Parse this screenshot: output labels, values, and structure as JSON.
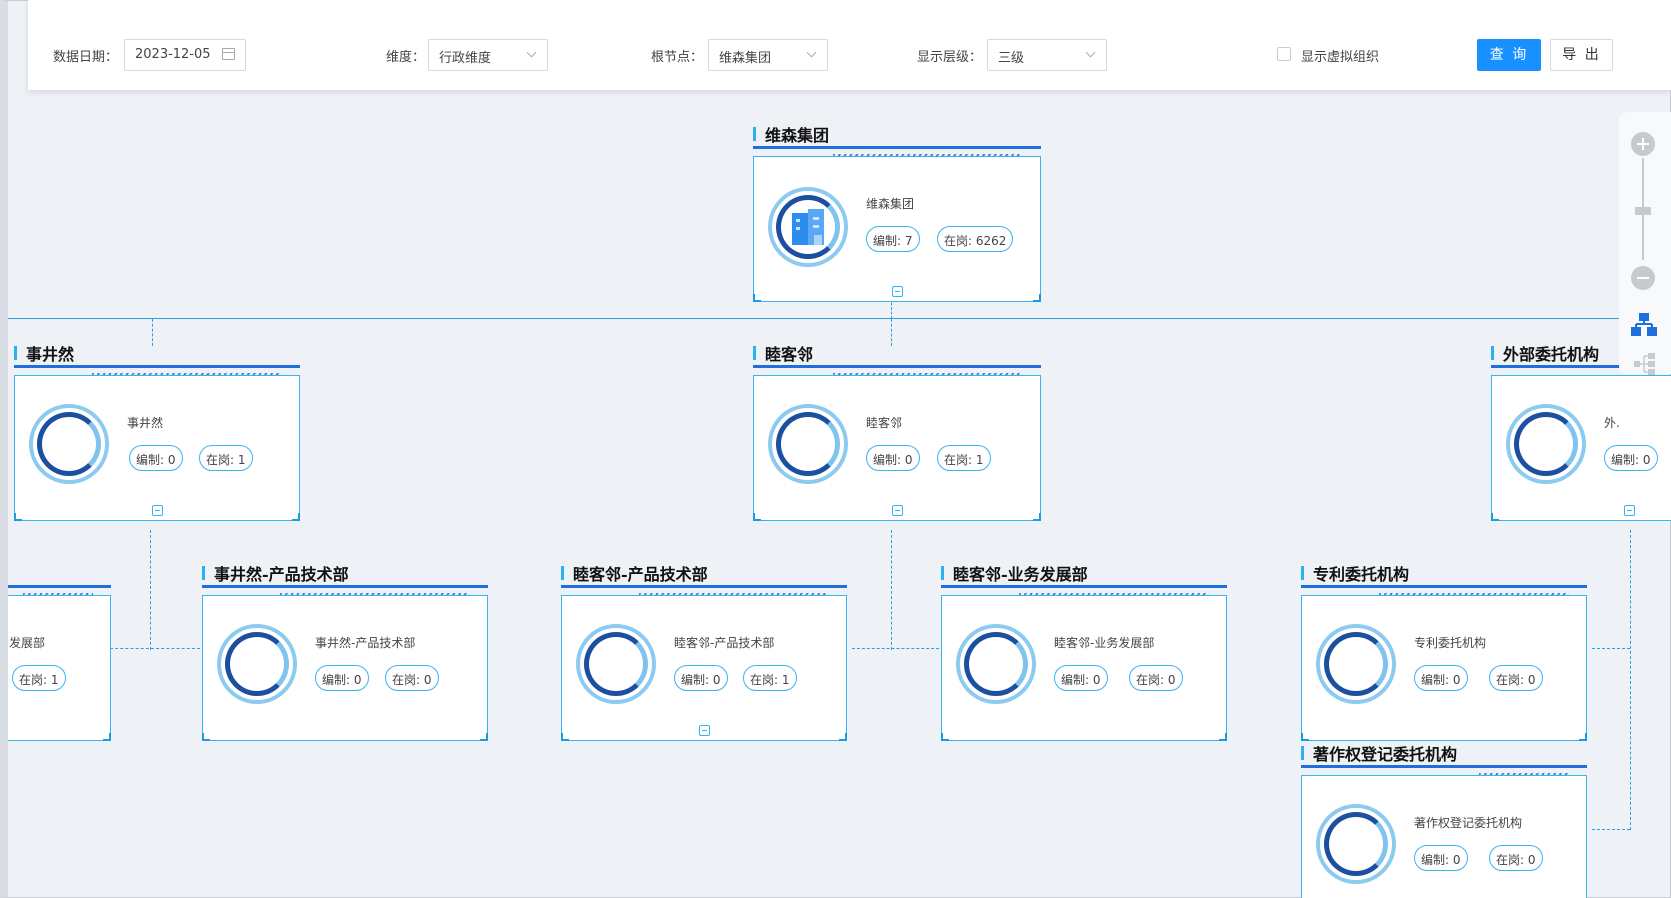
{
  "filters": {
    "date_label": "数据日期：",
    "date_value": "2023-12-05",
    "dimension_label": "维度：",
    "dimension_value": "行政维度",
    "root_label": "根节点：",
    "root_value": "维森集团",
    "level_label": "显示层级：",
    "level_value": "三级",
    "virtual_label": "显示虚拟组织",
    "query_button": "查 询",
    "export_button": "导 出"
  },
  "nodes": {
    "root": {
      "title": "维森集团",
      "name": "维森集团",
      "staffing": "编制: 7",
      "onpost": "在岗: 6262"
    },
    "shijingran": {
      "title": "事井然",
      "name": "事井然",
      "staffing": "编制: 0",
      "onpost": "在岗: 1"
    },
    "mukelin": {
      "title": "睦客邻",
      "name": "睦客邻",
      "staffing": "编制: 0",
      "onpost": "在岗: 1"
    },
    "external": {
      "title": "外部委托机构",
      "name": "外.",
      "staffing": "编制: 0"
    },
    "partial_left": {
      "name": "发展部",
      "onpost": "在岗: 1"
    },
    "sjr_tech": {
      "title": "事井然-产品技术部",
      "name": "事井然-产品技术部",
      "staffing": "编制: 0",
      "onpost": "在岗: 0"
    },
    "mkl_tech": {
      "title": "睦客邻-产品技术部",
      "name": "睦客邻-产品技术部",
      "staffing": "编制: 0",
      "onpost": "在岗: 1"
    },
    "mkl_biz": {
      "title": "睦客邻-业务发展部",
      "name": "睦客邻-业务发展部",
      "staffing": "编制: 0",
      "onpost": "在岗: 0"
    },
    "patent": {
      "title": "专利委托机构",
      "name": "专利委托机构",
      "staffing": "编制: 0",
      "onpost": "在岗: 0"
    },
    "copyright": {
      "title": "著作权登记委托机构",
      "name": "著作权登记委托机构",
      "staffing": "编制: 0",
      "onpost": "在岗: 0"
    }
  },
  "colors": {
    "primary": "#1890ff",
    "line": "#2b9fe0",
    "ring_dark": "#1c4fa0",
    "ring_light": "#8ccaf0"
  }
}
